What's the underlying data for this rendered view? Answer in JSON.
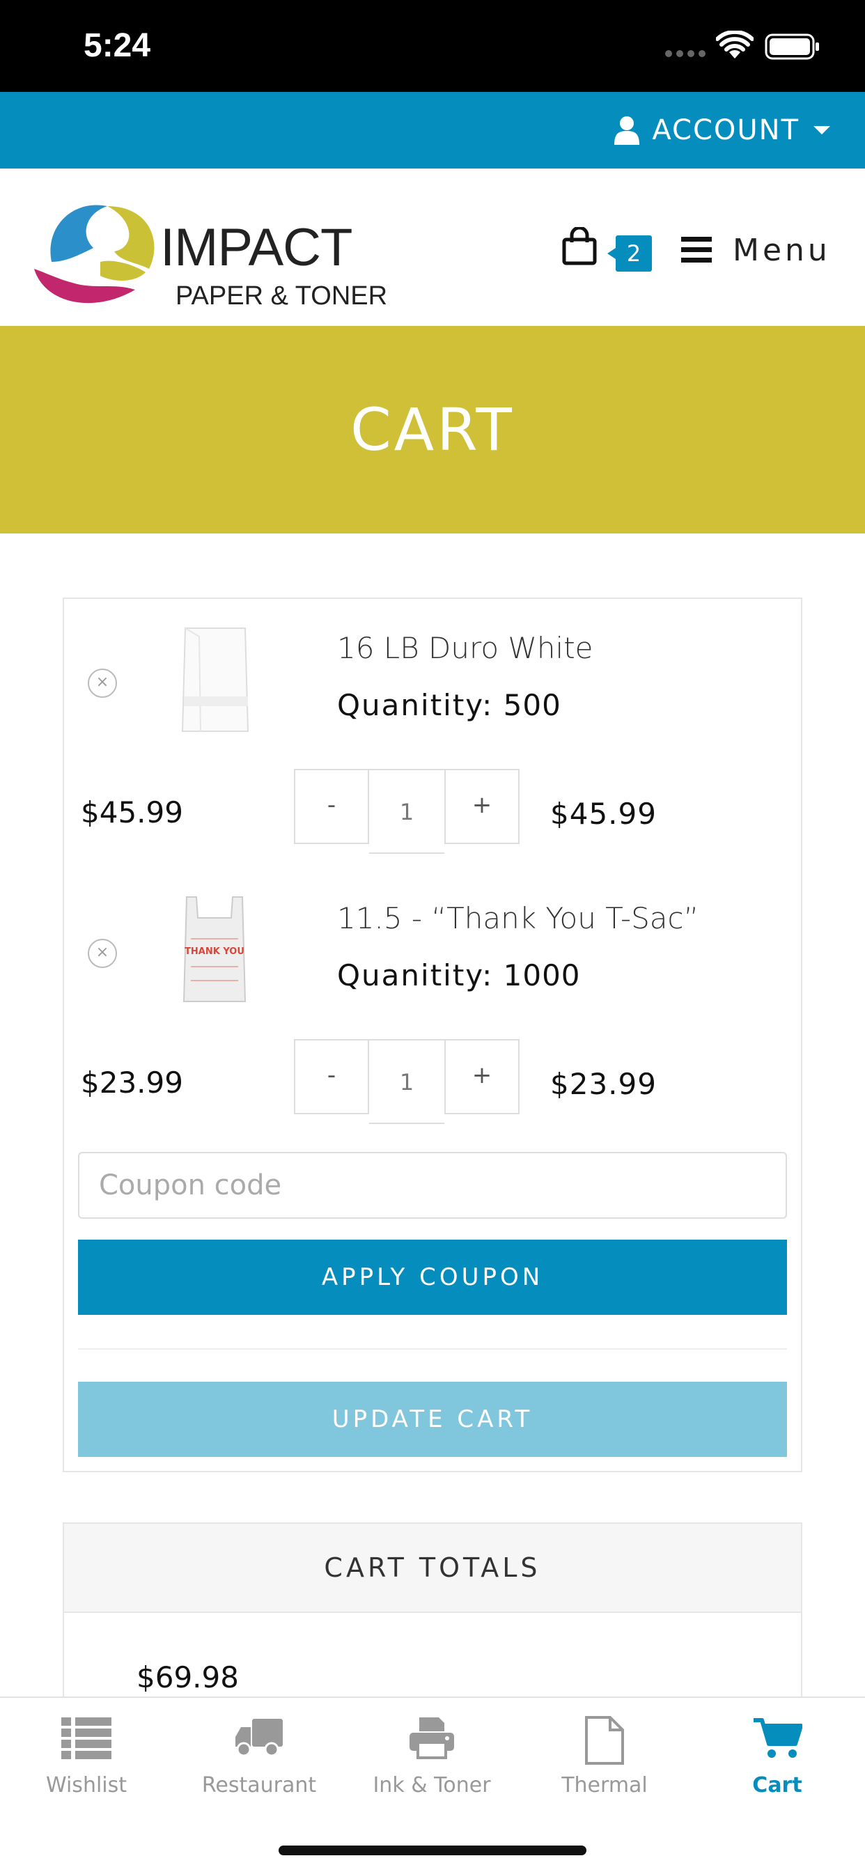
{
  "status_bar": {
    "time": "5:24"
  },
  "account_bar": {
    "label": "ACCOUNT"
  },
  "header": {
    "logo_line1": "IMPACT",
    "logo_line2": "PAPER & TONER",
    "cart_count": "2",
    "menu_label": "Menu"
  },
  "page_title": "CART",
  "cart": {
    "items": [
      {
        "name": "16 LB Duro White",
        "quantity_label": "Quanitity:",
        "quantity_value": "500",
        "price": "$45.99",
        "stepper_minus": "-",
        "stepper_value": "1",
        "stepper_plus": "+",
        "subtotal": "$45.99",
        "remove_symbol": "×"
      },
      {
        "name": "11.5 - “Thank You T-Sac”",
        "quantity_label": "Quanitity:",
        "quantity_value": "1000",
        "price": "$23.99",
        "stepper_minus": "-",
        "stepper_value": "1",
        "stepper_plus": "+",
        "subtotal": "$23.99",
        "remove_symbol": "×",
        "thumb_text": "THANK YOU"
      }
    ],
    "coupon_placeholder": "Coupon code",
    "apply_coupon_label": "APPLY COUPON",
    "update_cart_label": "UPDATE CART"
  },
  "totals": {
    "heading": "CART TOTALS",
    "amount": "$69.98"
  },
  "tabs": [
    {
      "label": "Wishlist",
      "icon": "list-icon",
      "active": false
    },
    {
      "label": "Restaurant",
      "icon": "truck-icon",
      "active": false
    },
    {
      "label": "Ink & Toner",
      "icon": "printer-icon",
      "active": false
    },
    {
      "label": "Thermal",
      "icon": "document-icon",
      "active": false
    },
    {
      "label": "Cart",
      "icon": "cart-icon",
      "active": true
    }
  ],
  "colors": {
    "accent_blue": "#048dbd",
    "title_band": "#cfc038",
    "update_button": "#80c6dd",
    "logo_blue": "#2b8fca",
    "logo_magenta": "#c2266d",
    "logo_yellow": "#cbc136"
  }
}
